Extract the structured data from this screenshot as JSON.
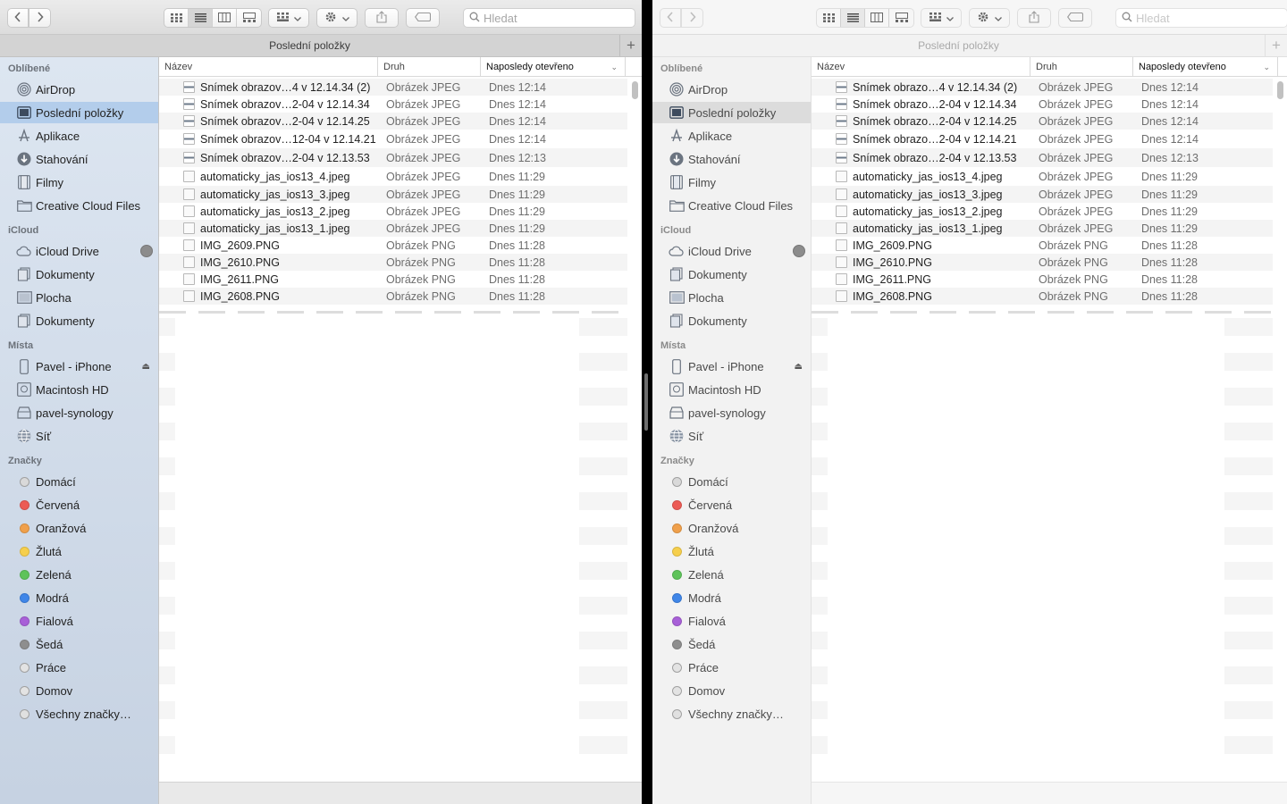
{
  "colors": {
    "accent_selected": "#b3cdeb",
    "sidebar_bg": "#c6d2e2"
  },
  "toolbar": {
    "back_icon": "chevron-left-icon",
    "forward_icon": "chevron-right-icon",
    "search_placeholder": "Hledat"
  },
  "tab": {
    "title": "Poslední položky",
    "add": "+"
  },
  "sidebar": {
    "favorites_title": "Oblíbené",
    "favorites": [
      {
        "label": "AirDrop",
        "icon": "airdrop-icon"
      },
      {
        "label": "Poslední položky",
        "icon": "recents-icon",
        "selected": true
      },
      {
        "label": "Aplikace",
        "icon": "applications-icon"
      },
      {
        "label": "Stahování",
        "icon": "downloads-icon"
      },
      {
        "label": "Filmy",
        "icon": "movies-icon"
      },
      {
        "label": "Creative Cloud Files",
        "icon": "folder-icon"
      }
    ],
    "icloud_title": "iCloud",
    "icloud": [
      {
        "label": "iCloud Drive",
        "icon": "cloud-icon"
      },
      {
        "label": "Dokumenty",
        "icon": "documents-icon"
      },
      {
        "label": "Plocha",
        "icon": "desktop-icon"
      },
      {
        "label": "Dokumenty",
        "icon": "documents-icon"
      }
    ],
    "places_title": "Místa",
    "places": [
      {
        "label": "Pavel - iPhone",
        "icon": "iphone-icon"
      },
      {
        "label": "Macintosh HD",
        "icon": "hard-drive-icon"
      },
      {
        "label": "pavel-synology",
        "icon": "server-icon"
      },
      {
        "label": "Síť",
        "icon": "network-icon"
      }
    ],
    "tags_title": "Značky",
    "tags": [
      {
        "label": "Domácí",
        "color": "#d9d9d9"
      },
      {
        "label": "Červená",
        "color": "#ec5b55"
      },
      {
        "label": "Oranžová",
        "color": "#f0a04b"
      },
      {
        "label": "Žlutá",
        "color": "#f6cf4c"
      },
      {
        "label": "Zelená",
        "color": "#5ec35a"
      },
      {
        "label": "Modrá",
        "color": "#3f86e8"
      },
      {
        "label": "Fialová",
        "color": "#a860d8"
      },
      {
        "label": "Šedá",
        "color": "#8e8e8e"
      },
      {
        "label": "Práce",
        "color": "#e3e3e3"
      },
      {
        "label": "Domov",
        "color": "#e3e3e3"
      },
      {
        "label": "Všechny značky…",
        "color": "#e0e0e0"
      }
    ]
  },
  "columns": {
    "name": "Název",
    "kind": "Druh",
    "date": "Naposledy otevřeno"
  },
  "left_files": [
    {
      "name": "Snímek obrazov…4 v 12.14.34 (2)",
      "kind": "Obrázek JPEG",
      "date": "Dnes 12:14",
      "img": true
    },
    {
      "name": "Snímek obrazov…2-04 v 12.14.34",
      "kind": "Obrázek JPEG",
      "date": "Dnes 12:14",
      "img": true
    },
    {
      "name": "Snímek obrazov…2-04 v 12.14.25",
      "kind": "Obrázek JPEG",
      "date": "Dnes 12:14",
      "img": true
    },
    {
      "name": "Snímek obrazov…12-04 v 12.14.21",
      "kind": "Obrázek JPEG",
      "date": "Dnes 12:14",
      "img": true
    },
    {
      "name": "Snímek obrazov…2-04 v 12.13.53",
      "kind": "Obrázek JPEG",
      "date": "Dnes 12:13",
      "img": true
    },
    {
      "name": "automaticky_jas_ios13_4.jpeg",
      "kind": "Obrázek JPEG",
      "date": "Dnes 11:29"
    },
    {
      "name": "automaticky_jas_ios13_3.jpeg",
      "kind": "Obrázek JPEG",
      "date": "Dnes 11:29"
    },
    {
      "name": "automaticky_jas_ios13_2.jpeg",
      "kind": "Obrázek JPEG",
      "date": "Dnes 11:29"
    },
    {
      "name": "automaticky_jas_ios13_1.jpeg",
      "kind": "Obrázek JPEG",
      "date": "Dnes 11:29"
    },
    {
      "name": "IMG_2609.PNG",
      "kind": "Obrázek PNG",
      "date": "Dnes 11:28"
    },
    {
      "name": "IMG_2610.PNG",
      "kind": "Obrázek PNG",
      "date": "Dnes 11:28"
    },
    {
      "name": "IMG_2611.PNG",
      "kind": "Obrázek PNG",
      "date": "Dnes 11:28"
    },
    {
      "name": "IMG_2608.PNG",
      "kind": "Obrázek PNG",
      "date": "Dnes 11:28"
    }
  ],
  "right_files": [
    {
      "name": "Snímek obrazo…4 v 12.14.34 (2)",
      "kind": "Obrázek JPEG",
      "date": "Dnes 12:14",
      "img": true
    },
    {
      "name": "Snímek obrazo…2-04 v 12.14.34",
      "kind": "Obrázek JPEG",
      "date": "Dnes 12:14",
      "img": true
    },
    {
      "name": "Snímek obrazo…2-04 v 12.14.25",
      "kind": "Obrázek JPEG",
      "date": "Dnes 12:14",
      "img": true
    },
    {
      "name": "Snímek obrazo…2-04 v 12.14.21",
      "kind": "Obrázek JPEG",
      "date": "Dnes 12:14",
      "img": true
    },
    {
      "name": "Snímek obrazo…2-04 v 12.13.53",
      "kind": "Obrázek JPEG",
      "date": "Dnes 12:13",
      "img": true
    },
    {
      "name": "automaticky_jas_ios13_4.jpeg",
      "kind": "Obrázek JPEG",
      "date": "Dnes 11:29"
    },
    {
      "name": "automaticky_jas_ios13_3.jpeg",
      "kind": "Obrázek JPEG",
      "date": "Dnes 11:29"
    },
    {
      "name": "automaticky_jas_ios13_2.jpeg",
      "kind": "Obrázek JPEG",
      "date": "Dnes 11:29"
    },
    {
      "name": "automaticky_jas_ios13_1.jpeg",
      "kind": "Obrázek JPEG",
      "date": "Dnes 11:29"
    },
    {
      "name": "IMG_2609.PNG",
      "kind": "Obrázek PNG",
      "date": "Dnes 11:28"
    },
    {
      "name": "IMG_2610.PNG",
      "kind": "Obrázek PNG",
      "date": "Dnes 11:28"
    },
    {
      "name": "IMG_2611.PNG",
      "kind": "Obrázek PNG",
      "date": "Dnes 11:28"
    },
    {
      "name": "IMG_2608.PNG",
      "kind": "Obrázek PNG",
      "date": "Dnes 11:28"
    }
  ]
}
